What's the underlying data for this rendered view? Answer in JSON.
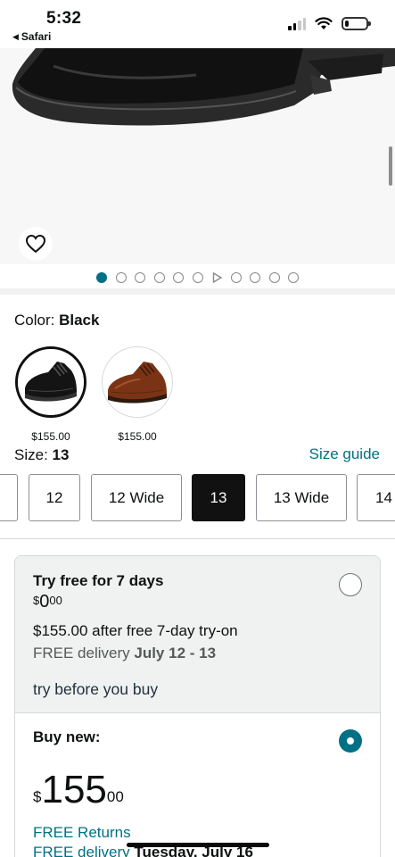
{
  "status_bar": {
    "time": "5:32",
    "back_app": "Safari",
    "signal_bars": 2,
    "battery_level": 0.2
  },
  "product": {
    "image_dots": {
      "count": 11,
      "active_index": 0,
      "video_index": 6
    }
  },
  "color": {
    "label": "Color:",
    "selected": "Black",
    "options": [
      {
        "name": "black-oxford",
        "price": "$155.00",
        "selected": true
      },
      {
        "name": "brown-oxford",
        "price": "$155.00",
        "selected": false
      }
    ]
  },
  "size": {
    "label": "Size:",
    "selected": "13",
    "guide_link": "Size guide",
    "options": [
      {
        "label": "",
        "selected": false
      },
      {
        "label": "12",
        "selected": false
      },
      {
        "label": "12 Wide",
        "selected": false
      },
      {
        "label": "13",
        "selected": true
      },
      {
        "label": "13 Wide",
        "selected": false
      },
      {
        "label": "14",
        "selected": false
      }
    ]
  },
  "try_free": {
    "title": "Try free for 7 days",
    "price_symbol": "$",
    "price_whole": "0",
    "price_fraction": "00",
    "after_price": "$155.00 after free 7-day try-on",
    "delivery_prefix": "FREE delivery",
    "delivery_dates": "July 12 - 13",
    "brand": "try before you buy",
    "selected": false
  },
  "buy_new": {
    "title": "Buy new:",
    "price_symbol": "$",
    "price_whole": "155",
    "price_fraction": "00",
    "returns_link": "FREE Returns",
    "delivery_prefix": "FREE delivery",
    "delivery_date": "Tuesday, July 16",
    "selected": true
  },
  "colors": {
    "accent": "#007185",
    "text": "#0f1111",
    "muted": "#565959",
    "selected_size_bg": "#111111"
  }
}
